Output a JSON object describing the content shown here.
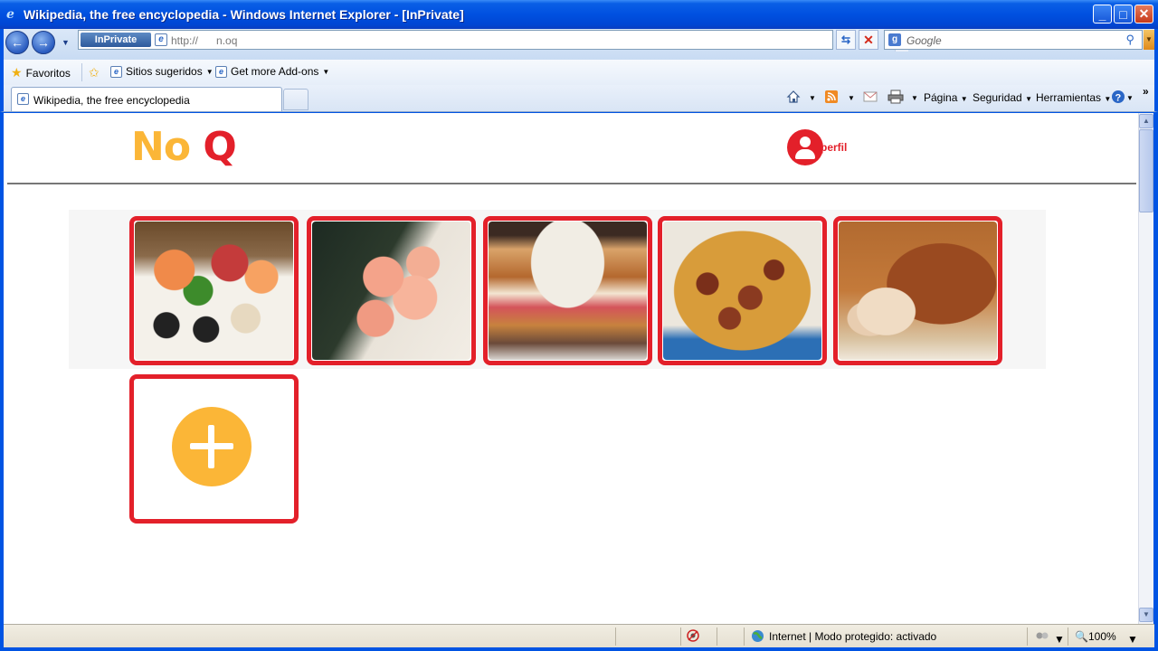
{
  "window": {
    "title": "Wikipedia, the free encyclopedia - Windows Internet Explorer - [InPrivate]"
  },
  "address_bar": {
    "inprivate_label": "InPrivate",
    "url": "http://      n.oq",
    "search_placeholder": "Google"
  },
  "favorites_bar": {
    "favorites_label": "Favoritos",
    "items": [
      {
        "label": "Sitios sugeridos",
        "has_dropdown": true
      },
      {
        "label": "Get more Add-ons",
        "has_dropdown": true
      }
    ]
  },
  "tabs": [
    {
      "title": "Wikipedia, the free encyclopedia",
      "active": true
    }
  ],
  "command_bar": {
    "page_label": "Página",
    "safety_label": "Seguridad",
    "tools_label": "Herramientas",
    "chevron": "»"
  },
  "site": {
    "logo_part1": "No",
    "logo_part2": "Q",
    "profile_label": "perfil",
    "colors": {
      "brand_yellow": "#fbb637",
      "brand_red": "#e3202a"
    },
    "food_cards": [
      {
        "name": "sushi",
        "image": "sushi-platter"
      },
      {
        "name": "temaki",
        "image": "shrimp-temaki"
      },
      {
        "name": "burger",
        "image": "fried-sandwich"
      },
      {
        "name": "spaghetti",
        "image": "spaghetti-meatballs"
      },
      {
        "name": "roast",
        "image": "roast-pork"
      }
    ],
    "add_card_icon": "plus-icon"
  },
  "status_bar": {
    "zone_text": "Internet | Modo protegido: activado",
    "zoom": "100%"
  }
}
